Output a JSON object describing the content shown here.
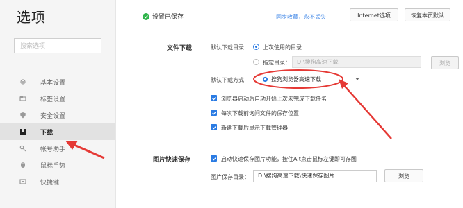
{
  "page": {
    "title": "选项"
  },
  "sidebar": {
    "search_placeholder": "搜索选项",
    "items": [
      {
        "label": "基本设置",
        "icon": "gear-icon"
      },
      {
        "label": "标签设置",
        "icon": "tab-icon"
      },
      {
        "label": "安全设置",
        "icon": "shield-icon"
      },
      {
        "label": "下载",
        "icon": "download-icon",
        "active": true
      },
      {
        "label": "帐号助手",
        "icon": "key-icon"
      },
      {
        "label": "鼠标手势",
        "icon": "mouse-icon"
      },
      {
        "label": "快捷键",
        "icon": "keyboard-icon"
      }
    ]
  },
  "topbar": {
    "saved_text": "设置已保存",
    "sync_link": "同步收藏，永不丢失",
    "internet_options_label": "Internet选项",
    "restore_defaults_label": "恢复本页默认"
  },
  "download": {
    "section_label": "文件下载",
    "dir_label": "默认下载目录",
    "option_last": "上次使用的目录",
    "option_specify": "指定目录：",
    "specify_path": "D:\\搜狗高速下载",
    "browse_label": "浏览",
    "method_label": "默认下载方式",
    "method_value": "搜狗浏览器高速下载",
    "checkboxes": [
      "浏览器启动后自动开始上次未完成下载任务",
      "每次下载前询问文件的保存位置",
      "新建下载后显示下载管理器"
    ]
  },
  "image_save": {
    "section_label": "图片快速保存",
    "enable_text": "启动快速保存图片功能，按住Alt点击鼠标左键即可存图",
    "path_label": "图片保存目录：",
    "path_value": "D:\\搜狗高速下载\\快速保存图片",
    "browse_label": "浏览"
  },
  "colors": {
    "accent": "#2a7be3",
    "annotation": "#e53935",
    "saved": "#2fb44a",
    "link": "#4a8de8"
  }
}
